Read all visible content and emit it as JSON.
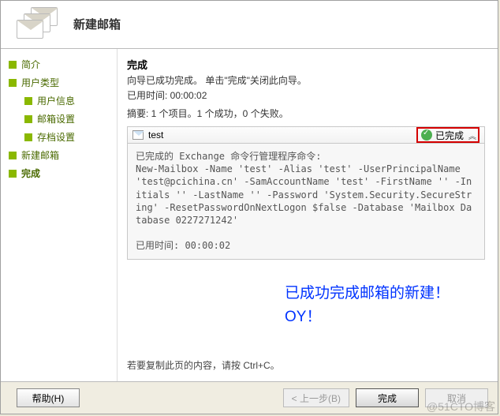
{
  "header": {
    "title": "新建邮箱"
  },
  "sidebar": {
    "items": [
      {
        "label": "简介"
      },
      {
        "label": "用户类型"
      },
      {
        "label": "用户信息"
      },
      {
        "label": "邮箱设置"
      },
      {
        "label": "存档设置"
      },
      {
        "label": "新建邮箱"
      },
      {
        "label": "完成"
      }
    ]
  },
  "content": {
    "title": "完成",
    "successLine": "向导已成功完成。 单击\"完成\"关闭此向导。",
    "elapsedLabel": "已用时间: 00:00:02",
    "summaryLine": "摘要: 1 个项目。1 个成功，0 个失败。",
    "result": {
      "name": "test",
      "status": "已完成"
    },
    "commandText": "已完成的 Exchange 命令行管理程序命令:\nNew-Mailbox -Name 'test' -Alias 'test' -UserPrincipalName 'test@pcichina.cn' -SamAccountName 'test' -FirstName '' -Initials '' -LastName '' -Password 'System.Security.SecureString' -ResetPasswordOnNextLogon $false -Database 'Mailbox Database 0227271242'\n\n已用时间: 00:00:02",
    "annotation": "已成功完成邮箱的新建！OY！",
    "copyHint": "若要复制此页的内容，请按 Ctrl+C。"
  },
  "footer": {
    "help": "帮助(H)",
    "back": "< 上一步(B)",
    "finish": "完成",
    "cancel": "取消"
  },
  "watermark": "@51CTO博客"
}
